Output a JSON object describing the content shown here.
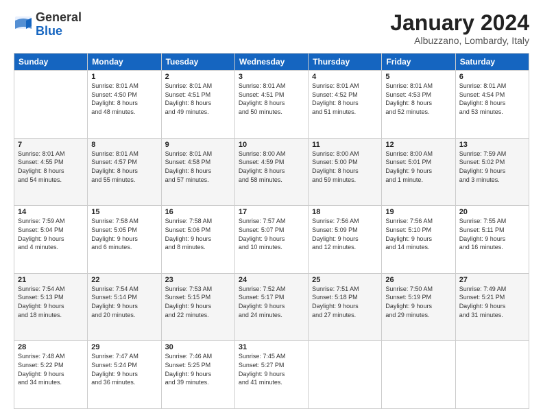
{
  "logo": {
    "general": "General",
    "blue": "Blue"
  },
  "header": {
    "month": "January 2024",
    "location": "Albuzzano, Lombardy, Italy"
  },
  "days_of_week": [
    "Sunday",
    "Monday",
    "Tuesday",
    "Wednesday",
    "Thursday",
    "Friday",
    "Saturday"
  ],
  "weeks": [
    [
      {
        "day": "",
        "info": ""
      },
      {
        "day": "1",
        "info": "Sunrise: 8:01 AM\nSunset: 4:50 PM\nDaylight: 8 hours\nand 48 minutes."
      },
      {
        "day": "2",
        "info": "Sunrise: 8:01 AM\nSunset: 4:51 PM\nDaylight: 8 hours\nand 49 minutes."
      },
      {
        "day": "3",
        "info": "Sunrise: 8:01 AM\nSunset: 4:51 PM\nDaylight: 8 hours\nand 50 minutes."
      },
      {
        "day": "4",
        "info": "Sunrise: 8:01 AM\nSunset: 4:52 PM\nDaylight: 8 hours\nand 51 minutes."
      },
      {
        "day": "5",
        "info": "Sunrise: 8:01 AM\nSunset: 4:53 PM\nDaylight: 8 hours\nand 52 minutes."
      },
      {
        "day": "6",
        "info": "Sunrise: 8:01 AM\nSunset: 4:54 PM\nDaylight: 8 hours\nand 53 minutes."
      }
    ],
    [
      {
        "day": "7",
        "info": "Sunrise: 8:01 AM\nSunset: 4:55 PM\nDaylight: 8 hours\nand 54 minutes."
      },
      {
        "day": "8",
        "info": "Sunrise: 8:01 AM\nSunset: 4:57 PM\nDaylight: 8 hours\nand 55 minutes."
      },
      {
        "day": "9",
        "info": "Sunrise: 8:01 AM\nSunset: 4:58 PM\nDaylight: 8 hours\nand 57 minutes."
      },
      {
        "day": "10",
        "info": "Sunrise: 8:00 AM\nSunset: 4:59 PM\nDaylight: 8 hours\nand 58 minutes."
      },
      {
        "day": "11",
        "info": "Sunrise: 8:00 AM\nSunset: 5:00 PM\nDaylight: 8 hours\nand 59 minutes."
      },
      {
        "day": "12",
        "info": "Sunrise: 8:00 AM\nSunset: 5:01 PM\nDaylight: 9 hours\nand 1 minute."
      },
      {
        "day": "13",
        "info": "Sunrise: 7:59 AM\nSunset: 5:02 PM\nDaylight: 9 hours\nand 3 minutes."
      }
    ],
    [
      {
        "day": "14",
        "info": "Sunrise: 7:59 AM\nSunset: 5:04 PM\nDaylight: 9 hours\nand 4 minutes."
      },
      {
        "day": "15",
        "info": "Sunrise: 7:58 AM\nSunset: 5:05 PM\nDaylight: 9 hours\nand 6 minutes."
      },
      {
        "day": "16",
        "info": "Sunrise: 7:58 AM\nSunset: 5:06 PM\nDaylight: 9 hours\nand 8 minutes."
      },
      {
        "day": "17",
        "info": "Sunrise: 7:57 AM\nSunset: 5:07 PM\nDaylight: 9 hours\nand 10 minutes."
      },
      {
        "day": "18",
        "info": "Sunrise: 7:56 AM\nSunset: 5:09 PM\nDaylight: 9 hours\nand 12 minutes."
      },
      {
        "day": "19",
        "info": "Sunrise: 7:56 AM\nSunset: 5:10 PM\nDaylight: 9 hours\nand 14 minutes."
      },
      {
        "day": "20",
        "info": "Sunrise: 7:55 AM\nSunset: 5:11 PM\nDaylight: 9 hours\nand 16 minutes."
      }
    ],
    [
      {
        "day": "21",
        "info": "Sunrise: 7:54 AM\nSunset: 5:13 PM\nDaylight: 9 hours\nand 18 minutes."
      },
      {
        "day": "22",
        "info": "Sunrise: 7:54 AM\nSunset: 5:14 PM\nDaylight: 9 hours\nand 20 minutes."
      },
      {
        "day": "23",
        "info": "Sunrise: 7:53 AM\nSunset: 5:15 PM\nDaylight: 9 hours\nand 22 minutes."
      },
      {
        "day": "24",
        "info": "Sunrise: 7:52 AM\nSunset: 5:17 PM\nDaylight: 9 hours\nand 24 minutes."
      },
      {
        "day": "25",
        "info": "Sunrise: 7:51 AM\nSunset: 5:18 PM\nDaylight: 9 hours\nand 27 minutes."
      },
      {
        "day": "26",
        "info": "Sunrise: 7:50 AM\nSunset: 5:19 PM\nDaylight: 9 hours\nand 29 minutes."
      },
      {
        "day": "27",
        "info": "Sunrise: 7:49 AM\nSunset: 5:21 PM\nDaylight: 9 hours\nand 31 minutes."
      }
    ],
    [
      {
        "day": "28",
        "info": "Sunrise: 7:48 AM\nSunset: 5:22 PM\nDaylight: 9 hours\nand 34 minutes."
      },
      {
        "day": "29",
        "info": "Sunrise: 7:47 AM\nSunset: 5:24 PM\nDaylight: 9 hours\nand 36 minutes."
      },
      {
        "day": "30",
        "info": "Sunrise: 7:46 AM\nSunset: 5:25 PM\nDaylight: 9 hours\nand 39 minutes."
      },
      {
        "day": "31",
        "info": "Sunrise: 7:45 AM\nSunset: 5:27 PM\nDaylight: 9 hours\nand 41 minutes."
      },
      {
        "day": "",
        "info": ""
      },
      {
        "day": "",
        "info": ""
      },
      {
        "day": "",
        "info": ""
      }
    ]
  ]
}
